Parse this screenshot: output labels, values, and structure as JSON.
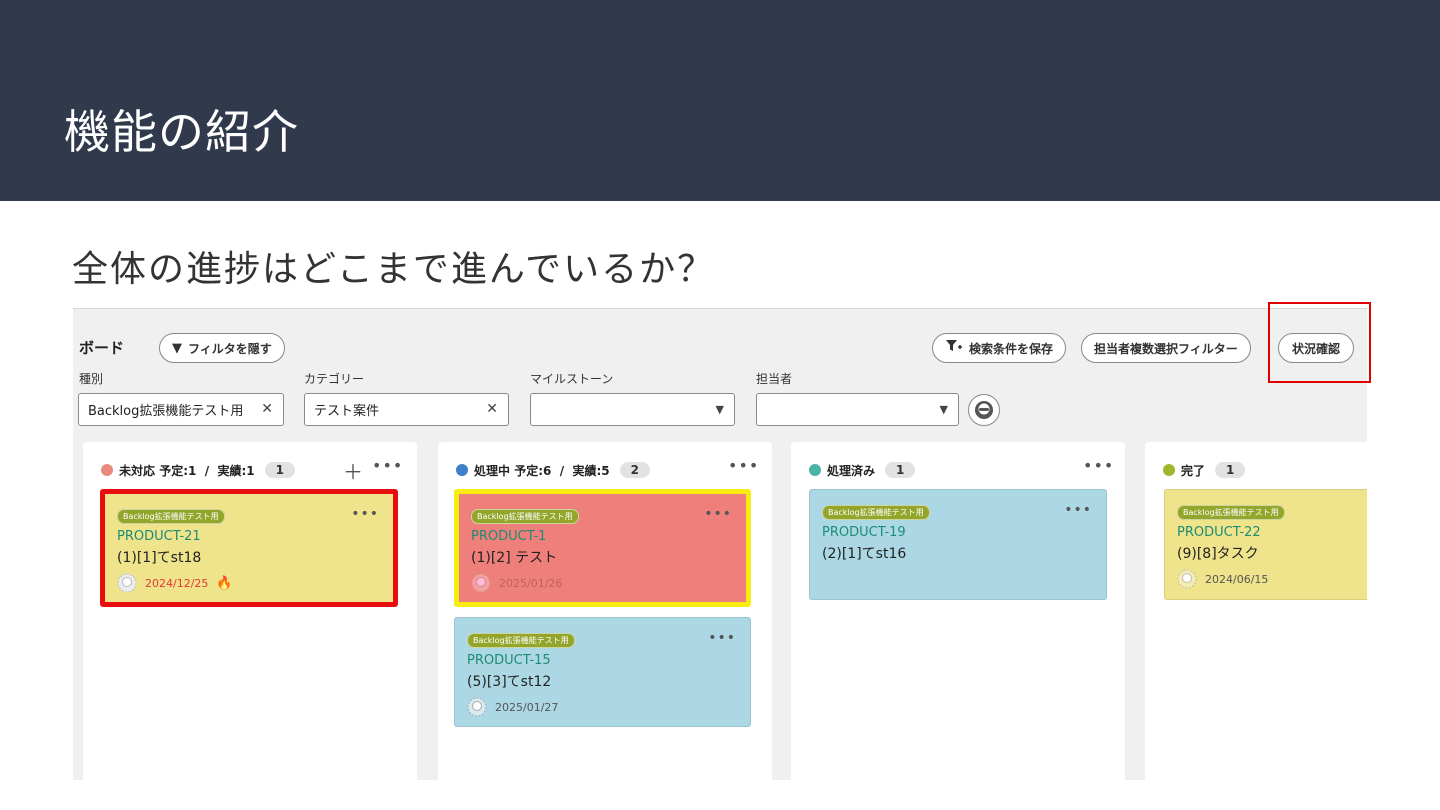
{
  "slide": {
    "title": "機能の紹介",
    "subtitle": "全体の進捗はどこまで進んでいるか？"
  },
  "board": {
    "title": "ボード",
    "hide_filter_label": "フィルタを隠す",
    "save_search_label": "検索条件を保存",
    "assignee_multi_filter_label": "担当者複数選択フィルター",
    "status_check_label": "状況確認",
    "filters": [
      {
        "label": "種別",
        "value": "Backlog拡張機能テスト用"
      },
      {
        "label": "カテゴリー",
        "value": "テスト案件"
      },
      {
        "label": "マイルストーン",
        "value": ""
      },
      {
        "label": "担当者",
        "value": ""
      }
    ],
    "columns": [
      {
        "name": "未対応",
        "stats": "予定:1  /  実績:1",
        "count": "1",
        "color": "#e88a80",
        "cards": [
          {
            "tag": "Backlog拡張機能テスト用",
            "key": "PRODUCT-21",
            "summary": "(1)[1]てst18",
            "date": "2024/12/25",
            "bg": "#efe38b",
            "border": "#e80e0e",
            "date_color": "#e53935",
            "fire": true
          }
        ]
      },
      {
        "name": "処理中",
        "stats": "予定:6  /  実績:5",
        "count": "2",
        "color": "#3f7fc9",
        "cards": [
          {
            "tag": "Backlog拡張機能テスト用",
            "key": "PRODUCT-1",
            "summary": "(1)[2] テスト",
            "date": "2025/01/26",
            "bg": "#ef7f7a",
            "border": "#f7ed12",
            "date_color": "#777",
            "fire": false
          },
          {
            "tag": "Backlog拡張機能テスト用",
            "key": "PRODUCT-15",
            "summary": "(5)[3]てst12",
            "date": "2025/01/27",
            "bg": "#acd8e6",
            "border": "#9cc3cf",
            "date_color": "#555",
            "fire": false
          }
        ]
      },
      {
        "name": "処理済み",
        "stats": "",
        "count": "1",
        "color": "#4bb3a5",
        "cards": [
          {
            "tag": "Backlog拡張機能テスト用",
            "key": "PRODUCT-19",
            "summary": "(2)[1]てst16",
            "date": "",
            "bg": "#acd8e6",
            "border": "#9cc3cf",
            "date_color": "#555",
            "fire": false
          }
        ]
      },
      {
        "name": "完了",
        "stats": "",
        "count": "1",
        "color": "#a3b42d",
        "cards": [
          {
            "tag": "Backlog拡張機能テスト用",
            "key": "PRODUCT-22",
            "summary": "(9)[8]タスク",
            "date": "2024/06/15",
            "bg": "#efe38b",
            "border": "#d9cf7a",
            "date_color": "#555",
            "fire": false
          }
        ]
      }
    ]
  },
  "icons": {
    "filter": "filter-icon",
    "filter_plus": "filter-plus-icon",
    "avatar": "avatar-icon",
    "more": "more-icon",
    "plus": "plus-icon",
    "fire": "fire-icon",
    "clear": "clear-icon",
    "dropdown": "chevron-down-icon"
  }
}
